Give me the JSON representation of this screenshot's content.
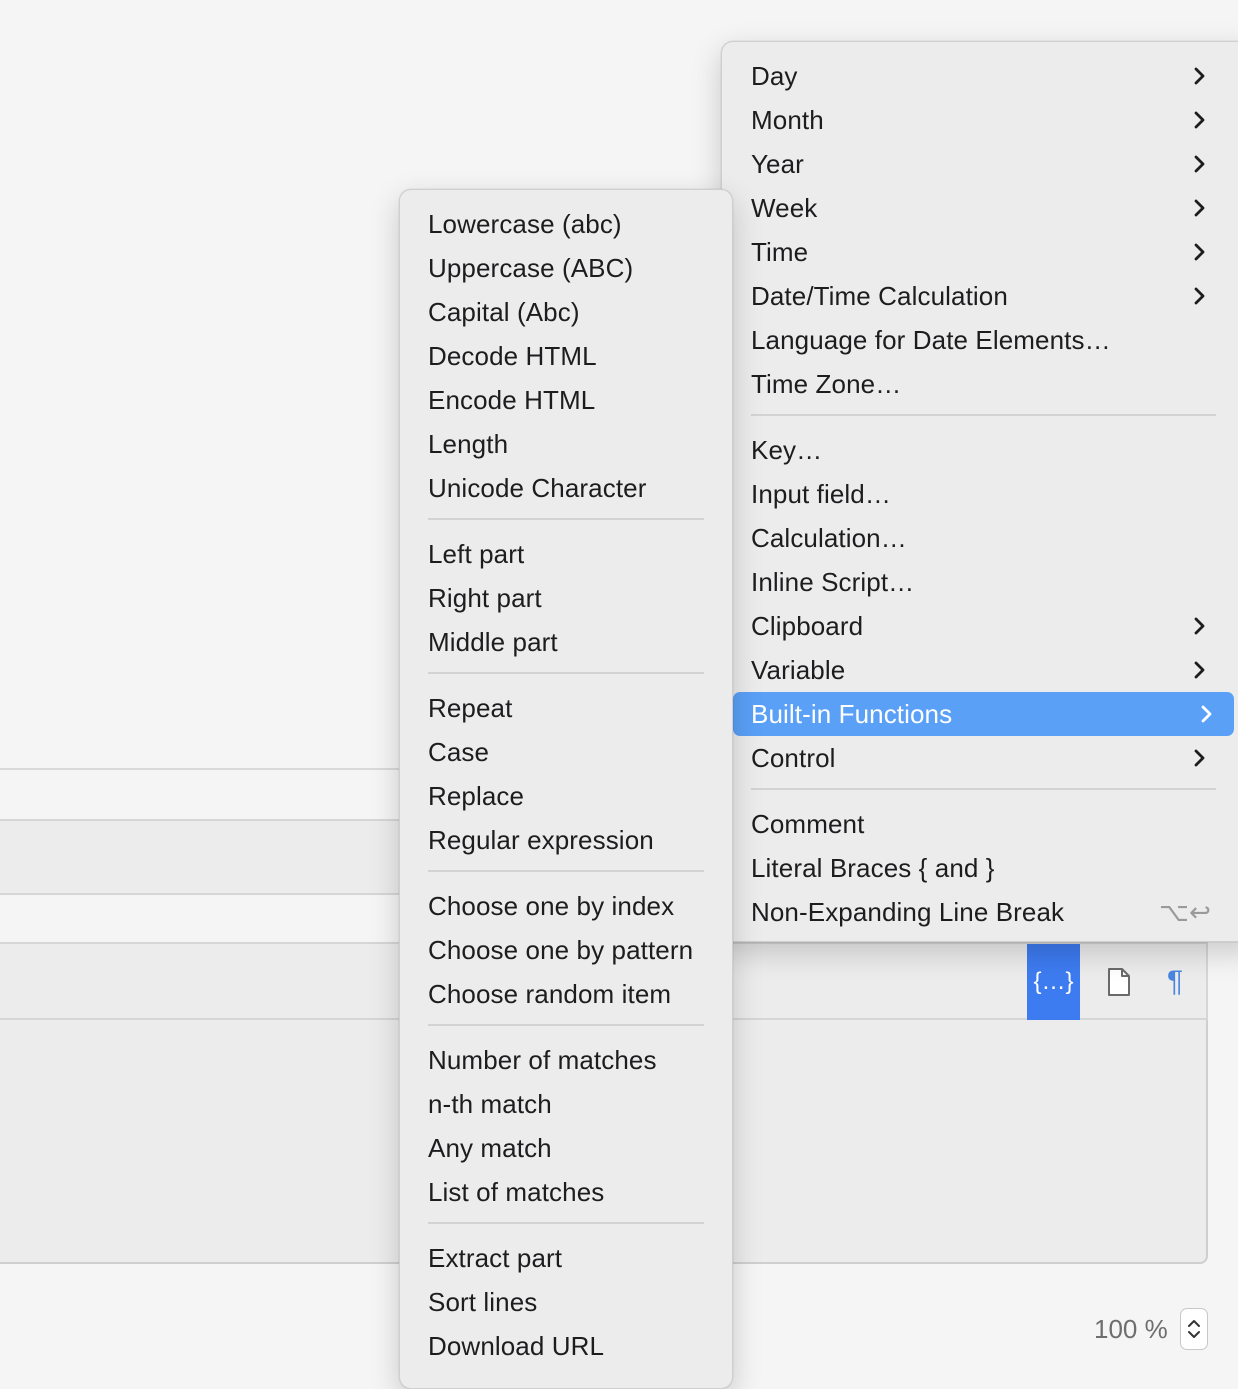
{
  "main_menu": {
    "items": [
      {
        "label": "Day"
      },
      {
        "label": "Month"
      },
      {
        "label": "Year"
      },
      {
        "label": "Week"
      },
      {
        "label": "Time"
      },
      {
        "label": "Date/Time Calculation"
      },
      {
        "label": "Language for Date Elements…"
      },
      {
        "label": "Time Zone…"
      },
      {
        "label": "Key…"
      },
      {
        "label": "Input field…"
      },
      {
        "label": "Calculation…"
      },
      {
        "label": "Inline Script…"
      },
      {
        "label": "Clipboard"
      },
      {
        "label": "Variable"
      },
      {
        "label": "Built-in Functions"
      },
      {
        "label": "Control"
      },
      {
        "label": "Comment"
      },
      {
        "label": "Literal Braces { and }"
      },
      {
        "label": "Non-Expanding Line Break",
        "shortcut": "⌥↩"
      }
    ]
  },
  "sub_menu": {
    "items": [
      {
        "label": "Lowercase (abc)"
      },
      {
        "label": "Uppercase (ABC)"
      },
      {
        "label": "Capital (Abc)"
      },
      {
        "label": "Decode HTML"
      },
      {
        "label": "Encode HTML"
      },
      {
        "label": "Length"
      },
      {
        "label": "Unicode Character"
      },
      {
        "label": "Left part"
      },
      {
        "label": "Right part"
      },
      {
        "label": "Middle part"
      },
      {
        "label": "Repeat"
      },
      {
        "label": "Case"
      },
      {
        "label": "Replace"
      },
      {
        "label": "Regular expression"
      },
      {
        "label": "Choose one by index"
      },
      {
        "label": "Choose one by pattern"
      },
      {
        "label": "Choose random item"
      },
      {
        "label": "Number of matches"
      },
      {
        "label": "n-th match"
      },
      {
        "label": "Any match"
      },
      {
        "label": "List of matches"
      },
      {
        "label": "Extract part"
      },
      {
        "label": "Sort lines"
      },
      {
        "label": "Download URL"
      }
    ]
  },
  "toolbar": {
    "placeholder_label": "{…}",
    "paragraph_label": "¶"
  },
  "zoom": {
    "value": "100 %"
  },
  "colors": {
    "selection": "#5aa0f7",
    "toolbar_active": "#3d7bf0"
  }
}
